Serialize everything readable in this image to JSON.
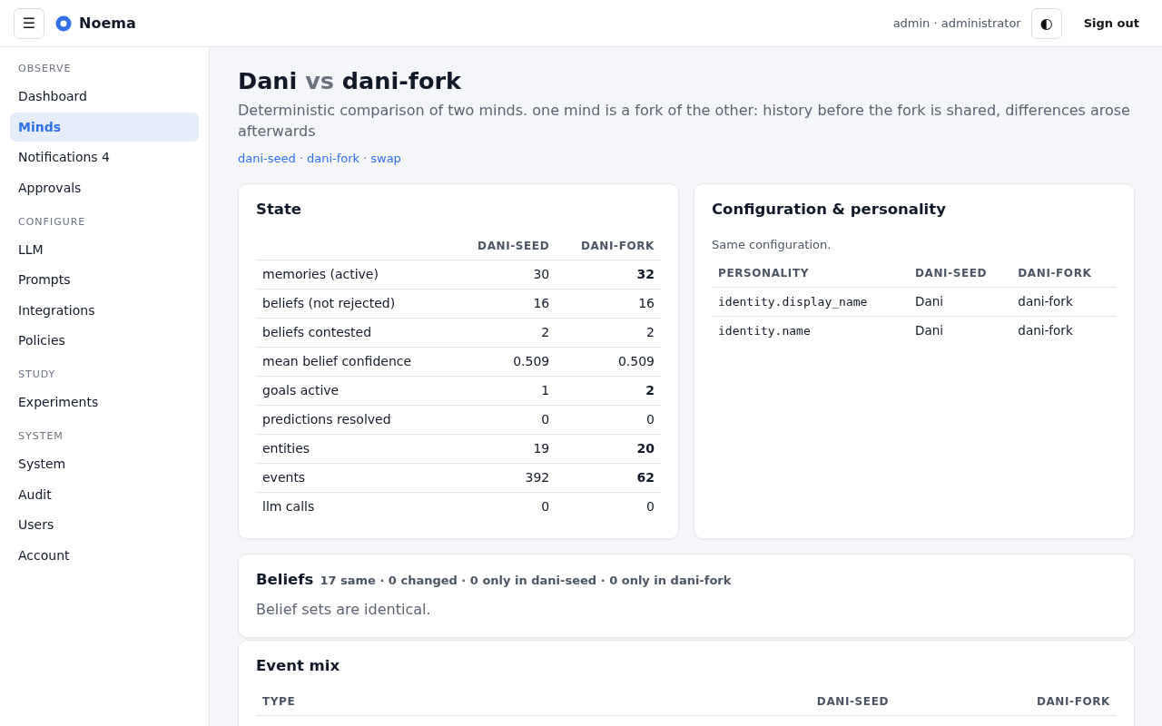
{
  "header": {
    "menu_glyph": "☰",
    "brand": "Noema",
    "user": "admin · administrator",
    "theme_glyph": "◐",
    "sign_out": "Sign out"
  },
  "sidebar": {
    "sections": [
      {
        "heading": "OBSERVE",
        "items": [
          {
            "label": "Dashboard",
            "selected": false
          },
          {
            "label": "Minds",
            "selected": true
          },
          {
            "label": "Notifications 4",
            "selected": false
          },
          {
            "label": "Approvals",
            "selected": false
          }
        ]
      },
      {
        "heading": "CONFIGURE",
        "items": [
          {
            "label": "LLM",
            "selected": false
          },
          {
            "label": "Prompts",
            "selected": false
          },
          {
            "label": "Integrations",
            "selected": false
          },
          {
            "label": "Policies",
            "selected": false
          }
        ]
      },
      {
        "heading": "STUDY",
        "items": [
          {
            "label": "Experiments",
            "selected": false
          }
        ]
      },
      {
        "heading": "SYSTEM",
        "items": [
          {
            "label": "System",
            "selected": false
          },
          {
            "label": "Audit",
            "selected": false
          },
          {
            "label": "Users",
            "selected": false
          },
          {
            "label": "Account",
            "selected": false
          }
        ]
      }
    ]
  },
  "page": {
    "title": {
      "left": "Dani",
      "joiner": "vs",
      "right": "dani-fork"
    },
    "subtitle": "Deterministic comparison of two minds. one mind is a fork of the other: history before the fork is shared, differences arose afterwards",
    "links": [
      "dani-seed",
      "dani-fork",
      "swap"
    ],
    "link_separator": "·"
  },
  "state": {
    "title": "State",
    "columns": [
      "DANI-SEED",
      "DANI-FORK"
    ],
    "rows": [
      {
        "label": "memories (active)",
        "seed": "30",
        "fork": "32",
        "changed": true
      },
      {
        "label": "beliefs (not rejected)",
        "seed": "16",
        "fork": "16",
        "changed": false
      },
      {
        "label": "beliefs contested",
        "seed": "2",
        "fork": "2",
        "changed": false
      },
      {
        "label": "mean belief confidence",
        "seed": "0.509",
        "fork": "0.509",
        "changed": false
      },
      {
        "label": "goals active",
        "seed": "1",
        "fork": "2",
        "changed": true
      },
      {
        "label": "predictions resolved",
        "seed": "0",
        "fork": "0",
        "changed": false
      },
      {
        "label": "entities",
        "seed": "19",
        "fork": "20",
        "changed": true
      },
      {
        "label": "events",
        "seed": "392",
        "fork": "62",
        "changed": true
      },
      {
        "label": "llm calls",
        "seed": "0",
        "fork": "0",
        "changed": false
      }
    ]
  },
  "configuration": {
    "title": "Configuration & personality",
    "note": "Same configuration.",
    "columns": [
      "PERSONALITY",
      "DANI-SEED",
      "DANI-FORK"
    ],
    "rows": [
      {
        "key": "identity.display_name",
        "seed": "Dani",
        "fork": "dani-fork"
      },
      {
        "key": "identity.name",
        "seed": "Dani",
        "fork": "dani-fork"
      }
    ]
  },
  "beliefs": {
    "title": "Beliefs",
    "summary": "17 same · 0 changed · 0 only in dani-seed · 0 only in dani-fork",
    "message": "Belief sets are identical."
  },
  "event_mix": {
    "title": "Event mix",
    "columns": [
      "TYPE",
      "DANI-SEED",
      "DANI-FORK"
    ]
  }
}
